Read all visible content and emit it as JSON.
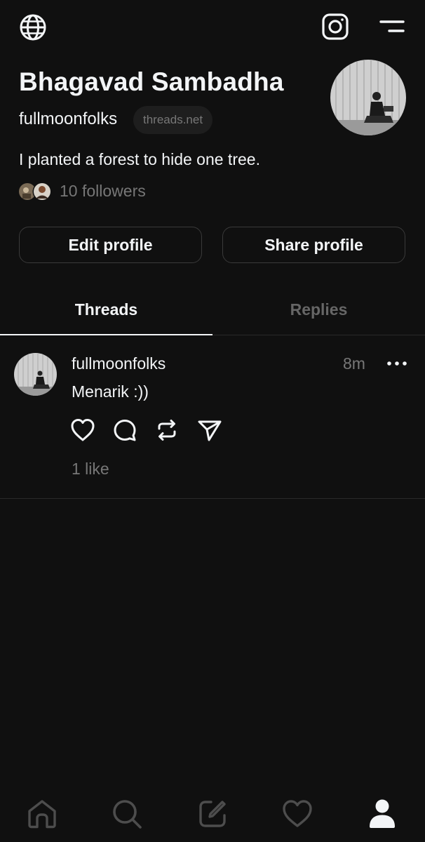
{
  "header": {
    "globe_icon": "globe-icon",
    "instagram_icon": "instagram-icon",
    "menu_icon": "menu-icon"
  },
  "profile": {
    "name": "Bhagavad Sambadha",
    "username": "fullmoonfolks",
    "domain_badge": "threads.net",
    "bio": "I planted a forest to hide one tree.",
    "followers": "10 followers"
  },
  "actions": {
    "edit_label": "Edit profile",
    "share_label": "Share profile"
  },
  "tabs": [
    {
      "label": "Threads",
      "active": true
    },
    {
      "label": "Replies",
      "active": false
    }
  ],
  "post": {
    "author": "fullmoonfolks",
    "time": "8m",
    "text": "Menarik :))",
    "likes": "1 like"
  },
  "bottom_nav": [
    {
      "icon": "home-icon"
    },
    {
      "icon": "search-icon"
    },
    {
      "icon": "compose-icon"
    },
    {
      "icon": "heart-icon"
    },
    {
      "icon": "profile-icon",
      "active": true
    }
  ],
  "colors": {
    "background": "#101010",
    "text": "#f3f5f7",
    "muted": "#777777",
    "border": "#3a3a3a"
  }
}
